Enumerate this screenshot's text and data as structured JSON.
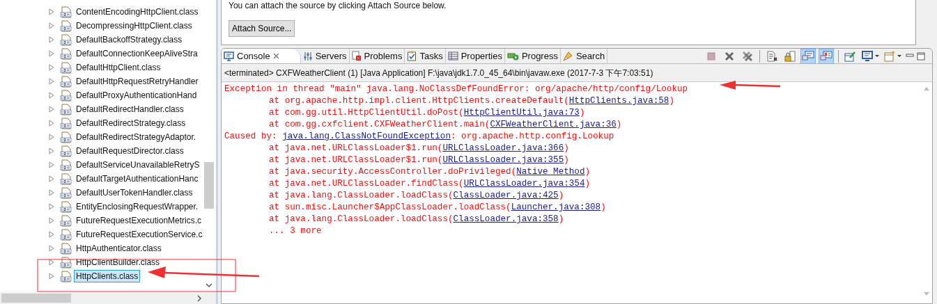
{
  "tree": {
    "items": [
      {
        "label": "ContentEncodingHttpClient.class",
        "selected": false
      },
      {
        "label": "DecompressingHttpClient.class",
        "selected": false
      },
      {
        "label": "DefaultBackoffStrategy.class",
        "selected": false
      },
      {
        "label": "DefaultConnectionKeepAliveStra",
        "selected": false
      },
      {
        "label": "DefaultHttpClient.class",
        "selected": false
      },
      {
        "label": "DefaultHttpRequestRetryHandler",
        "selected": false
      },
      {
        "label": "DefaultProxyAuthenticationHand",
        "selected": false
      },
      {
        "label": "DefaultRedirectHandler.class",
        "selected": false
      },
      {
        "label": "DefaultRedirectStrategy.class",
        "selected": false
      },
      {
        "label": "DefaultRedirectStrategyAdaptor.",
        "selected": false
      },
      {
        "label": "DefaultRequestDirector.class",
        "selected": false
      },
      {
        "label": "DefaultServiceUnavailableRetryS",
        "selected": false
      },
      {
        "label": "DefaultTargetAuthenticationHanc",
        "selected": false
      },
      {
        "label": "DefaultUserTokenHandler.class",
        "selected": false
      },
      {
        "label": "EntityEnclosingRequestWrapper.",
        "selected": false
      },
      {
        "label": "FutureRequestExecutionMetrics.c",
        "selected": false
      },
      {
        "label": "FutureRequestExecutionService.c",
        "selected": false
      },
      {
        "label": "HttpAuthenticator.class",
        "selected": false
      },
      {
        "label": "HttpClientBuilder.class",
        "selected": false
      },
      {
        "label": "HttpClients.class",
        "selected": true
      }
    ]
  },
  "editor": {
    "message": "You can attach the source by clicking Attach Source below.",
    "button": "Attach Source..."
  },
  "tabs": [
    {
      "label": "Console",
      "kind": "console",
      "selected": true
    },
    {
      "label": "Servers",
      "kind": "servers",
      "selected": false
    },
    {
      "label": "Problems",
      "kind": "problems",
      "selected": false
    },
    {
      "label": "Tasks",
      "kind": "tasks",
      "selected": false
    },
    {
      "label": "Properties",
      "kind": "properties",
      "selected": false
    },
    {
      "label": "Progress",
      "kind": "progress",
      "selected": false
    },
    {
      "label": "Search",
      "kind": "search",
      "selected": false
    }
  ],
  "toolbar": [
    {
      "kind": "terminate",
      "pressed": false
    },
    {
      "kind": "remove",
      "pressed": false
    },
    {
      "kind": "remove-all",
      "pressed": false
    },
    {
      "kind": "sep"
    },
    {
      "kind": "clear",
      "pressed": false
    },
    {
      "kind": "scroll-lock",
      "pressed": false
    },
    {
      "kind": "show-out",
      "pressed": true
    },
    {
      "kind": "show-err",
      "pressed": true
    },
    {
      "kind": "sep"
    },
    {
      "kind": "pin",
      "pressed": false
    },
    {
      "kind": "display",
      "pressed": false
    },
    {
      "kind": "new-console",
      "pressed": false
    }
  ],
  "console": {
    "status": "<terminated> CXFWeatherClient (1) [Java Application] F:\\java\\jdk1.7.0_45_64\\bin\\javaw.exe (2017-7-3 下午7:03:51)",
    "lines": [
      {
        "indented": false,
        "parts": [
          {
            "text": "Exception in thread \"main\" java.lang.NoClassDefFoundError: org/apache/http/config/Lookup",
            "link": false
          }
        ]
      },
      {
        "indented": true,
        "parts": [
          {
            "text": "at org.apache.http.impl.client.HttpClients.createDefault(",
            "link": false
          },
          {
            "text": "HttpClients.java:58",
            "link": true
          },
          {
            "text": ")",
            "link": false
          }
        ]
      },
      {
        "indented": true,
        "parts": [
          {
            "text": "at com.gg.util.HttpClientUtil.doPost(",
            "link": false
          },
          {
            "text": "HttpClientUtil.java:73",
            "link": true
          },
          {
            "text": ")",
            "link": false
          }
        ]
      },
      {
        "indented": true,
        "parts": [
          {
            "text": "at com.gg.cxfclient.CXFWeatherClient.main(",
            "link": false
          },
          {
            "text": "CXFWeatherClient.java:36",
            "link": true
          },
          {
            "text": ")",
            "link": false
          }
        ]
      },
      {
        "indented": false,
        "parts": [
          {
            "text": "Caused by: ",
            "link": false
          },
          {
            "text": "java.lang.ClassNotFoundException",
            "link": true
          },
          {
            "text": ": org.apache.http.config.Lookup",
            "link": false
          }
        ]
      },
      {
        "indented": true,
        "parts": [
          {
            "text": "at java.net.URLClassLoader$1.run(",
            "link": false
          },
          {
            "text": "URLClassLoader.java:366",
            "link": true
          },
          {
            "text": ")",
            "link": false
          }
        ]
      },
      {
        "indented": true,
        "parts": [
          {
            "text": "at java.net.URLClassLoader$1.run(",
            "link": false
          },
          {
            "text": "URLClassLoader.java:355",
            "link": true
          },
          {
            "text": ")",
            "link": false
          }
        ]
      },
      {
        "indented": true,
        "parts": [
          {
            "text": "at java.security.AccessController.doPrivileged(",
            "link": false
          },
          {
            "text": "Native Method",
            "link": true
          },
          {
            "text": ")",
            "link": false
          }
        ]
      },
      {
        "indented": true,
        "parts": [
          {
            "text": "at java.net.URLClassLoader.findClass(",
            "link": false
          },
          {
            "text": "URLClassLoader.java:354",
            "link": true
          },
          {
            "text": ")",
            "link": false
          }
        ]
      },
      {
        "indented": true,
        "parts": [
          {
            "text": "at java.lang.ClassLoader.loadClass(",
            "link": false
          },
          {
            "text": "ClassLoader.java:425",
            "link": true
          },
          {
            "text": ")",
            "link": false
          }
        ]
      },
      {
        "indented": true,
        "parts": [
          {
            "text": "at sun.misc.Launcher$AppClassLoader.loadClass(",
            "link": false
          },
          {
            "text": "Launcher.java:308",
            "link": true
          },
          {
            "text": ")",
            "link": false
          }
        ]
      },
      {
        "indented": true,
        "parts": [
          {
            "text": "at java.lang.ClassLoader.loadClass(",
            "link": false
          },
          {
            "text": "ClassLoader.java:358",
            "link": true
          },
          {
            "text": ")",
            "link": false
          }
        ]
      },
      {
        "indented": true,
        "parts": [
          {
            "text": "... 3 more",
            "link": false
          }
        ]
      }
    ]
  }
}
